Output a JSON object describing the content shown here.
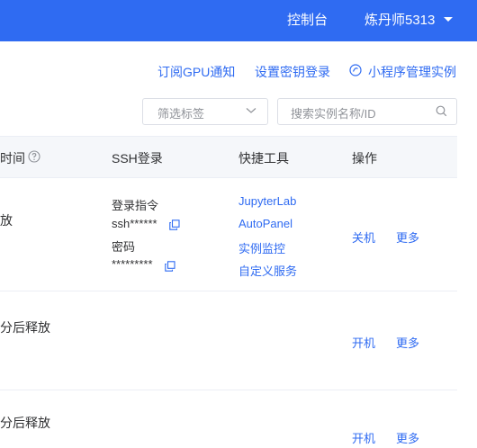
{
  "topbar": {
    "console": "控制台",
    "user": "炼丹师5313"
  },
  "links": {
    "gpu_notice": "订阅GPU通知",
    "ssh_key": "设置密钥登录",
    "mini_program": "小程序管理实例"
  },
  "filters": {
    "tag_placeholder": "筛选标签",
    "search_placeholder": "搜索实例名称/ID"
  },
  "table": {
    "headers": {
      "time": "时间",
      "ssh": "SSH登录",
      "tools": "快捷工具",
      "ops": "操作"
    },
    "rows": [
      {
        "time_fragment": "放",
        "ssh_cmd_label": "登录指令",
        "ssh_cmd": "ssh******",
        "pwd_label": "密码",
        "pwd": "*********",
        "tools": [
          "JupyterLab",
          "AutoPanel",
          "实例监控",
          "自定义服务"
        ],
        "action": "关机",
        "more": "更多"
      },
      {
        "time_fragment": "分后释放",
        "action": "开机",
        "more": "更多"
      },
      {
        "time_fragment": "分后释放",
        "action": "开机",
        "more": "更多"
      }
    ]
  },
  "colors": {
    "brand": "#2f6bf2",
    "header_bg": "#f5f7fa",
    "border": "#ebeef5"
  }
}
